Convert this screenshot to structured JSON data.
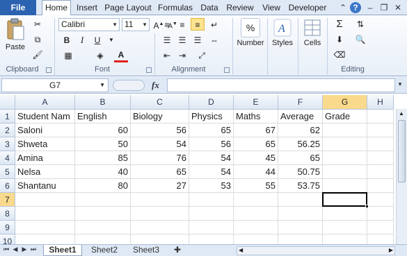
{
  "ribbon_tabs": {
    "file": "File",
    "items": [
      "Home",
      "Insert",
      "Page Layout",
      "Formulas",
      "Data",
      "Review",
      "View",
      "Developer"
    ]
  },
  "clipboard": {
    "paste": "Paste",
    "label": "Clipboard"
  },
  "font": {
    "name": "Calibri",
    "size": "11",
    "bold": "B",
    "italic": "I",
    "underline": "U",
    "grow": "A",
    "color_letter": "A",
    "label": "Font",
    "accent_color": "#e02020"
  },
  "alignment": {
    "label": "Alignment"
  },
  "number": {
    "label": "Number",
    "symbol": "%"
  },
  "styles": {
    "label": "Styles"
  },
  "cells": {
    "label": "Cells"
  },
  "editing": {
    "label": "Editing",
    "sum": "Σ"
  },
  "formula_bar": {
    "name_box": "G7",
    "fx": "fx",
    "value": ""
  },
  "sheet": {
    "columns": [
      "A",
      "B",
      "C",
      "D",
      "E",
      "F",
      "G",
      "H"
    ],
    "rows": [
      "1",
      "2",
      "3",
      "4",
      "5",
      "6",
      "7",
      "8",
      "9",
      "10"
    ],
    "active_cell": "G7",
    "data": [
      [
        "Student Nam",
        "English",
        "Biology",
        "Physics",
        "Maths",
        "Average",
        "Grade"
      ],
      [
        "Saloni",
        "60",
        "56",
        "65",
        "67",
        "62",
        ""
      ],
      [
        "Shweta",
        "50",
        "54",
        "56",
        "65",
        "56.25",
        ""
      ],
      [
        "Amina",
        "85",
        "76",
        "54",
        "45",
        "65",
        ""
      ],
      [
        "Nelsa",
        "40",
        "65",
        "54",
        "44",
        "50.75",
        ""
      ],
      [
        "Shantanu",
        "80",
        "27",
        "53",
        "55",
        "53.75",
        ""
      ]
    ]
  },
  "sheet_tabs": [
    "Sheet1",
    "Sheet2",
    "Sheet3"
  ],
  "colors": {
    "file_tab": "#2b63b0",
    "active_header": "#f9d98b",
    "ribbon_bg": "#dfe9f5"
  }
}
